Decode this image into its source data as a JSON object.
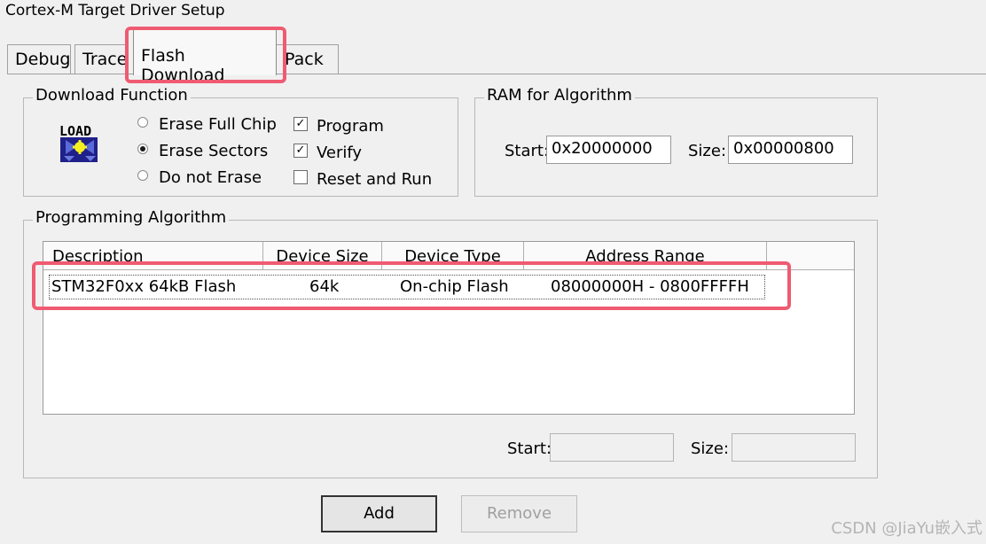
{
  "window": {
    "title": "Cortex-M Target Driver Setup"
  },
  "tabs": [
    {
      "label": "Debug"
    },
    {
      "label": "Trace"
    },
    {
      "label": "Flash Download"
    },
    {
      "label": "Pack"
    }
  ],
  "download_function": {
    "legend": "Download Function",
    "icon": "load-icon",
    "icon_text": "LOAD",
    "erase_options": [
      {
        "label": "Erase Full Chip",
        "selected": false
      },
      {
        "label": "Erase Sectors",
        "selected": true
      },
      {
        "label": "Do not Erase",
        "selected": false
      }
    ],
    "checks": [
      {
        "label": "Program",
        "checked": true
      },
      {
        "label": "Verify",
        "checked": true
      },
      {
        "label": "Reset and Run",
        "checked": false
      }
    ]
  },
  "ram_for_algorithm": {
    "legend": "RAM for Algorithm",
    "start_label": "Start:",
    "start_value": "0x20000000",
    "size_label": "Size:",
    "size_value": "0x00000800"
  },
  "programming_algorithm": {
    "legend": "Programming Algorithm",
    "columns": [
      "Description",
      "Device Size",
      "Device Type",
      "Address Range"
    ],
    "rows": [
      {
        "description": "STM32F0xx 64kB Flash",
        "device_size": "64k",
        "device_type": "On-chip Flash",
        "address_range": "08000000H - 0800FFFFH"
      }
    ],
    "start_label": "Start:",
    "start_value": "",
    "size_label": "Size:",
    "size_value": ""
  },
  "buttons": {
    "add": "Add",
    "remove": "Remove"
  },
  "watermark": "CSDN @JiaYu嵌入式",
  "colors": {
    "highlight": "#ef5b72",
    "background": "#f0f0f0"
  }
}
